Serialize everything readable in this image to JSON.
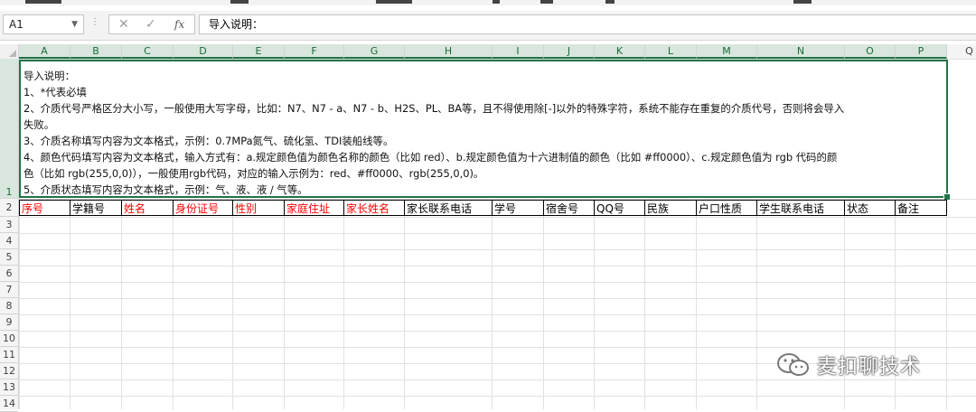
{
  "formula_bar": {
    "name_box": "A1",
    "cancel_icon": "✕",
    "enter_icon": "✓",
    "fx_label": "fx",
    "formula_text": "导入说明："
  },
  "columns": [
    "A",
    "B",
    "C",
    "D",
    "E",
    "F",
    "G",
    "H",
    "I",
    "J",
    "K",
    "L",
    "M",
    "N",
    "O",
    "P",
    "Q"
  ],
  "rows": [
    "1",
    "2",
    "3",
    "4",
    "5",
    "6",
    "7",
    "8",
    "9",
    "10",
    "11",
    "12",
    "13",
    "14"
  ],
  "instructions": {
    "line1": "导入说明：",
    "line2": "1、*代表必填",
    "line3": "2、介质代号严格区分大小写，一般使用大写字母，比如：N7、N7 - a、N7 - b、H2S、PL、BA等，且不得使用除[-]以外的特殊字符，系统不能存在重复的介质代号，否则将会导入",
    "line4": "失败。",
    "line5": "3、介质名称填写内容为文本格式，示例：0.7MPa氮气、硫化氢、TDI装船线等。",
    "line6": "4、颜色代码填写内容为文本格式，输入方式有：a.规定颜色值为颜色名称的颜色（比如 red）、b.规定颜色值为十六进制值的颜色（比如 #ff0000）、c.规定颜色值为 rgb 代码的颜",
    "line7": "色（比如 rgb(255,0,0)），一般使用rgb代码，对应的输入示例为：red、#ff0000、rgb(255,0,0)。",
    "line8": "5、介质状态填写内容为文本格式，示例：气、液、液 / 气等。"
  },
  "header_row": {
    "c0": "序号",
    "c1": "学籍号",
    "c2": "姓名",
    "c3": "身份证号",
    "c4": "性别",
    "c5": "家庭住址",
    "c6": "家长姓名",
    "c7": "家长联系电话",
    "c8": "学号",
    "c9": "宿舍号",
    "c10": "QQ号",
    "c11": "民族",
    "c12": "户口性质",
    "c13": "学生联系电话",
    "c14": "状态",
    "c15": "备注"
  },
  "required_color": "#ff0000",
  "selection_color": "#217346",
  "watermark": "麦扣聊技术"
}
